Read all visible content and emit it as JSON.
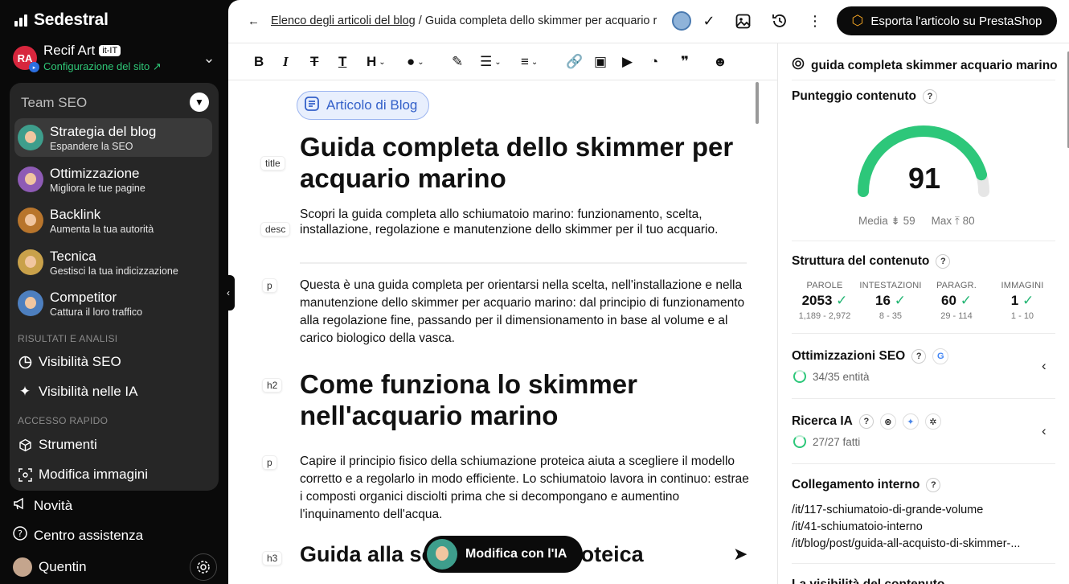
{
  "app": {
    "name": "Sedestral"
  },
  "site": {
    "initials": "RA",
    "name": "Recif Art",
    "locale": "it-IT",
    "config_label": "Configurazione del sito ↗"
  },
  "team": {
    "title": "Team SEO"
  },
  "agents": [
    {
      "title": "Strategia del blog",
      "subtitle": "Espandere la SEO",
      "color": "#3e9e8c"
    },
    {
      "title": "Ottimizzazione",
      "subtitle": "Migliora le tue pagine",
      "color": "#8e5bb5"
    },
    {
      "title": "Backlink",
      "subtitle": "Aumenta la tua autorità",
      "color": "#b8752c"
    },
    {
      "title": "Tecnica",
      "subtitle": "Gestisci la tua indicizzazione",
      "color": "#c9a14a"
    },
    {
      "title": "Competitor",
      "subtitle": "Cattura il loro traffico",
      "color": "#4d7fbf"
    }
  ],
  "sections": {
    "results": "RISULTATI E ANALISI",
    "quick": "ACCESSO RAPIDO"
  },
  "nav": {
    "seo_visibility": "Visibilità SEO",
    "ai_visibility": "Visibilità nelle IA",
    "tools": "Strumenti",
    "edit_images": "Modifica immagini"
  },
  "bottom_nav": {
    "news": "Novità",
    "help": "Centro assistenza",
    "user": "Quentin"
  },
  "header": {
    "breadcrumb_link": "Elenco degli articoli del blog",
    "breadcrumb_sep": " / ",
    "breadcrumb_current": "Guida completa dello skimmer per acquario r",
    "export_label": "Esporta l'articolo su PrestaShop"
  },
  "editor": {
    "badge": "Articolo di Blog",
    "tags": {
      "title": "title",
      "desc": "desc",
      "p": "p",
      "h2": "h2",
      "h3": "h3"
    },
    "title": "Guida completa dello skimmer per acquario marino",
    "description": "Scopri la guida completa allo schiumatoio marino: funzionamento, scelta, installazione, regolazione e manutenzione dello skimmer per il tuo acquario.",
    "p1": "Questa è una guida completa per orientarsi nella scelta, nell'installazione e nella manutenzione dello skimmer per acquario marino: dal principio di funzionamento alla regolazione fine, passando per il dimensionamento in base al volume e al carico biologico della vasca.",
    "h2": "Come funziona lo skimmer nell'acquario marino",
    "p2": "Capire il principio fisico della schiumazione proteica aiuta a scegliere il modello corretto e a regolarlo in modo efficiente. Lo schiumatoio lavora in continuo: estrae i composti organici disciolti prima che si decompongano e aumentino l'inquinamento dell'acqua.",
    "h3": "Guida alla schiumazione proteica",
    "ai_button": "Modifica con l'IA"
  },
  "panel": {
    "keyword": "guida completa skimmer acquario marino",
    "score_title": "Punteggio contenuto",
    "score": 91,
    "score_max": 100,
    "media_label": "Media",
    "media_value": "59",
    "max_label": "Max",
    "max_value": "80",
    "structure_title": "Struttura del contenuto",
    "stats": [
      {
        "label": "PAROLE",
        "value": "2053",
        "range": "1,189 - 2,972"
      },
      {
        "label": "INTESTAZIONI",
        "value": "16",
        "range": "8 - 35"
      },
      {
        "label": "PARAGR.",
        "value": "60",
        "range": "29 - 114"
      },
      {
        "label": "IMMAGINI",
        "value": "1",
        "range": "1 - 10"
      }
    ],
    "seo_title": "Ottimizzazioni SEO",
    "seo_progress": "34/35 entità",
    "ai_title": "Ricerca IA",
    "ai_progress": "27/27 fatti",
    "links_title": "Collegamento interno",
    "links": [
      "/it/117-schiumatoio-di-grande-volume",
      "/it/41-schiumatoio-interno",
      "/it/blog/post/guida-all-acquisto-di-skimmer-..."
    ],
    "next_title": "La visibilità del contenuto"
  },
  "colors": {
    "accent_green": "#2dc77a",
    "brand_blue": "#3360c9",
    "gauge_track": "#e6e6e6"
  }
}
